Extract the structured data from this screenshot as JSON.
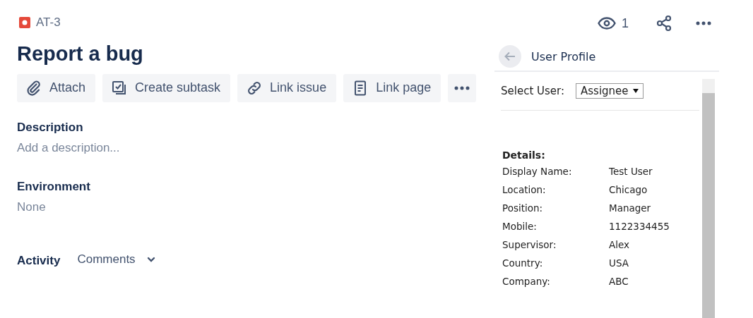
{
  "issue_key": "AT-3",
  "watchers": "1",
  "title": "Report a bug",
  "actions": [
    {
      "kind": "attach",
      "label": "Attach"
    },
    {
      "kind": "subtask",
      "label": "Create subtask"
    },
    {
      "kind": "link",
      "label": "Link issue"
    },
    {
      "kind": "page",
      "label": "Link page"
    },
    {
      "kind": "more"
    }
  ],
  "fields": [
    {
      "label": "Description",
      "value": "Add a description..."
    },
    {
      "label": "Environment",
      "value": "None"
    }
  ],
  "activity": {
    "label": "Activity",
    "filter": "Comments"
  },
  "panel": {
    "title": "User Profile",
    "select_label": "Select User:",
    "select_value": "Assignee",
    "details_title": "Details:",
    "details": [
      {
        "label": "Display Name:",
        "value": "Test User"
      },
      {
        "label": "Location:",
        "value": "Chicago"
      },
      {
        "label": "Position:",
        "value": "Manager"
      },
      {
        "label": "Mobile:",
        "value": "1122334455"
      },
      {
        "label": "Supervisor:",
        "value": "Alex"
      },
      {
        "label": "Country:",
        "value": "USA"
      },
      {
        "label": "Company:",
        "value": "ABC"
      }
    ]
  }
}
